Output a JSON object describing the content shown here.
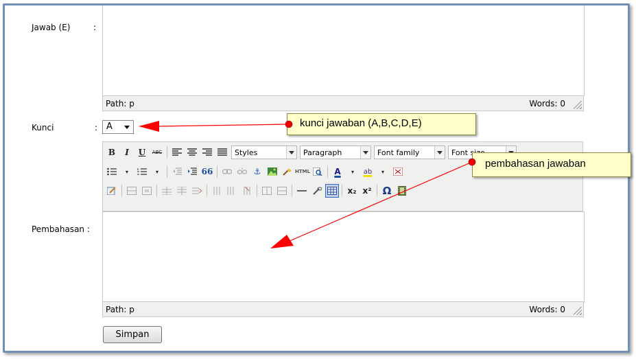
{
  "form": {
    "jawab_e_label": "Jawab (E)",
    "colon": ":",
    "kunci_label": "Kunci",
    "kunci_colon": ":",
    "kunci_value": "A",
    "pembahasan_label": "Pembahasan :",
    "submit_label": "Simpan"
  },
  "editor_top": {
    "path": "Path: p",
    "words": "Words: 0"
  },
  "editor_bottom": {
    "path": "Path: p",
    "words": "Words: 0"
  },
  "toolbar": {
    "row1": {
      "bold": "B",
      "italic": "I",
      "underline": "U",
      "strike": "ABC",
      "styles": "Styles",
      "paragraph": "Paragraph",
      "font_family": "Font family",
      "font_size": "Font size"
    },
    "row2": {
      "blockquote": "66",
      "html": "HTML",
      "text_color": "A",
      "bg_color": "ab"
    },
    "row3": {
      "subscript": "x₂",
      "superscript": "x²",
      "omega": "Ω"
    }
  },
  "callouts": {
    "kunci": "kunci jawaban (A,B,C,D,E)",
    "pembahasan": "pembahasan jawaban"
  },
  "colors": {
    "frame": "#6f8fb7",
    "toolbar_bg": "#f0f0ee",
    "callout_bg": "#ffffcc",
    "arrow": "#ff0000"
  }
}
